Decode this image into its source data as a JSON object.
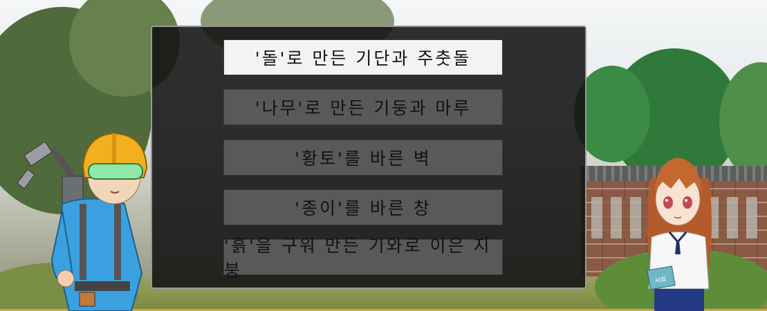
{
  "quiz": {
    "options": [
      {
        "label": "'돌'로 만든 기단과 주춧돌",
        "selected": true
      },
      {
        "label": "'나무'로 만든 기둥과 마루",
        "selected": false
      },
      {
        "label": "'황토'를 바른 벽",
        "selected": false
      },
      {
        "label": "'종이'를 바른 창",
        "selected": false
      },
      {
        "label": "'흙'을 구워 만든 기와로 이은 지붕",
        "selected": false
      }
    ]
  },
  "characters": {
    "girl_book_text": "사회"
  },
  "colors": {
    "panel_bg": "#121212",
    "option_bg": "#595959",
    "option_selected_bg": "#f3f3f3",
    "worker_suit": "#3aa0e0",
    "helmet": "#f2b01e"
  }
}
